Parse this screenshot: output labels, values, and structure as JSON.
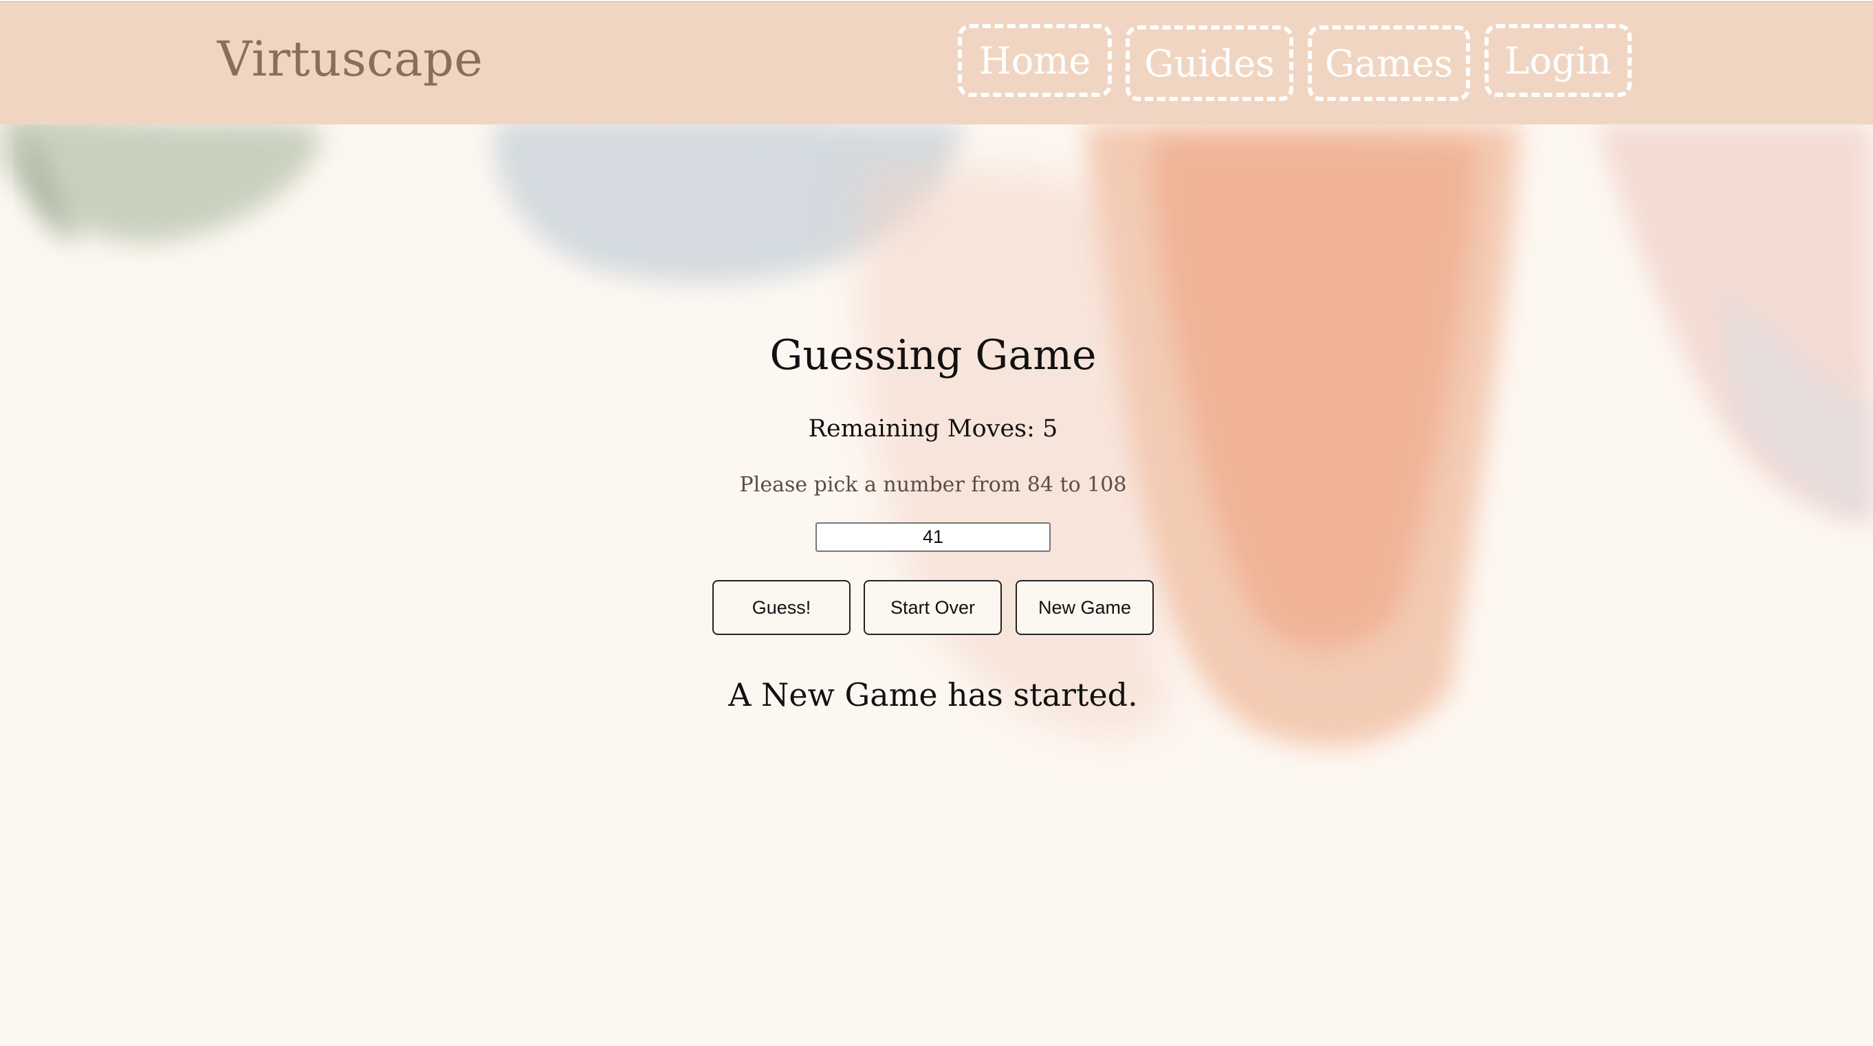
{
  "header": {
    "brand": "Virtuscape",
    "nav": {
      "home": "Home",
      "guides": "Guides",
      "games": "Games",
      "login": "Login"
    }
  },
  "game": {
    "title": "Guessing Game",
    "remaining_moves": "Remaining Moves: 5",
    "prompt": "Please pick a number from 84 to 108",
    "input_value": "41",
    "buttons": {
      "guess": "Guess!",
      "start_over": "Start Over",
      "new_game": "New Game"
    },
    "status": "A New Game has started."
  },
  "colors": {
    "header_bg": "#f0d6c2",
    "page_bg": "#fdf7f1",
    "brand_text": "#8a6e5c"
  }
}
